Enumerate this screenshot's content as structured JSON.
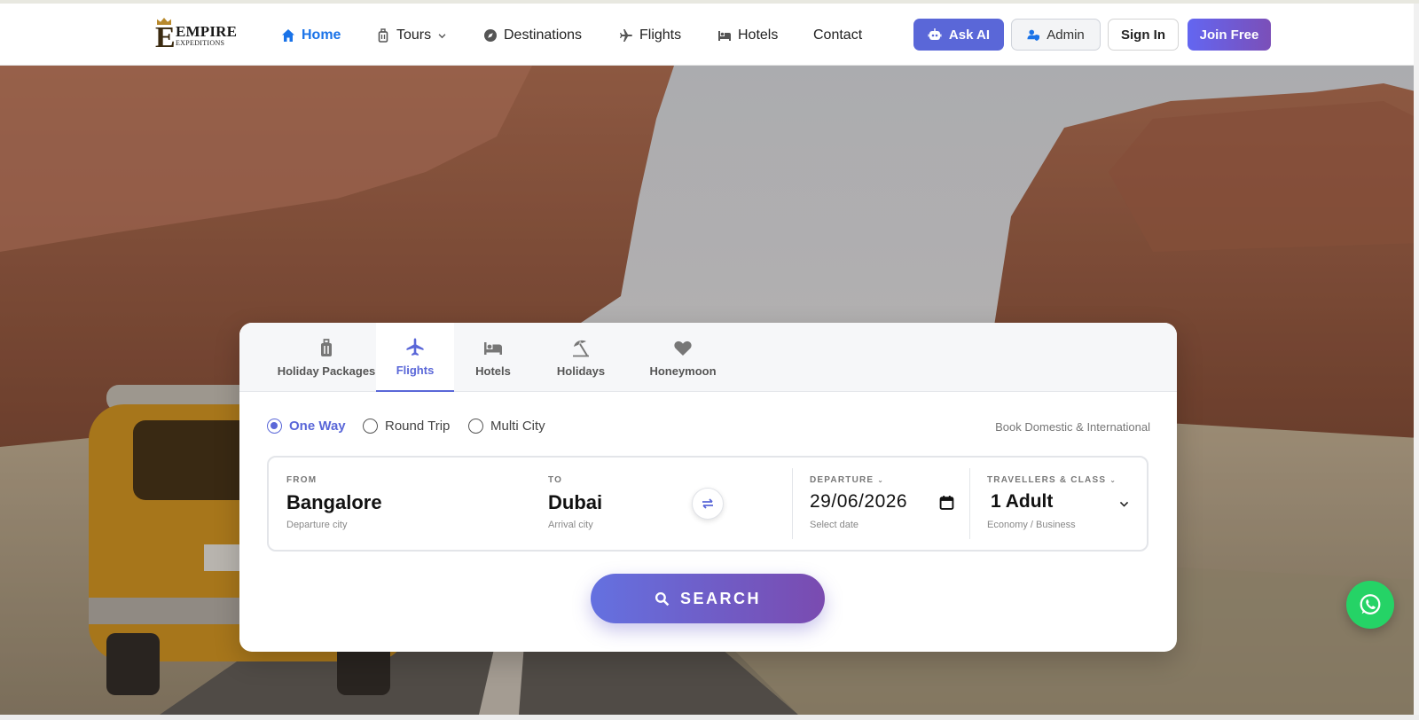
{
  "brand": {
    "line1": "EMPIRE",
    "line2": "EXPEDITIONS",
    "mark": "E"
  },
  "nav": {
    "home": "Home",
    "tours": "Tours",
    "destinations": "Destinations",
    "flights": "Flights",
    "hotels": "Hotels",
    "contact": "Contact"
  },
  "actions": {
    "ask_ai": "Ask AI",
    "admin": "Admin",
    "sign_in": "Sign In",
    "join": "Join Free"
  },
  "search": {
    "tabs": [
      {
        "label": "Holiday Packages",
        "icon": "suitcase-icon"
      },
      {
        "label": "Flights",
        "icon": "plane-icon"
      },
      {
        "label": "Hotels",
        "icon": "bed-icon"
      },
      {
        "label": "Holidays",
        "icon": "umbrella-beach-icon"
      },
      {
        "label": "Honeymoon",
        "icon": "heart-icon"
      }
    ],
    "active_tab": "Flights",
    "trip_types": [
      "One Way",
      "Round Trip",
      "Multi City"
    ],
    "selected_trip": "One Way",
    "note": "Book Domestic & International",
    "from": {
      "label": "FROM",
      "value": "Bangalore",
      "sub": "Departure city"
    },
    "to": {
      "label": "TO",
      "value": "Dubai",
      "sub": "Arrival city"
    },
    "departure": {
      "label": "DEPARTURE",
      "value": "29/06/2026",
      "sub": "Select date"
    },
    "travellers": {
      "label": "TRAVELLERS & CLASS",
      "value": "1 Adult",
      "sub": "Economy / Business"
    },
    "button": "SEARCH"
  },
  "colors": {
    "accent": "#5a67d8",
    "link_active": "#1a73e8",
    "whatsapp": "#25d366"
  }
}
